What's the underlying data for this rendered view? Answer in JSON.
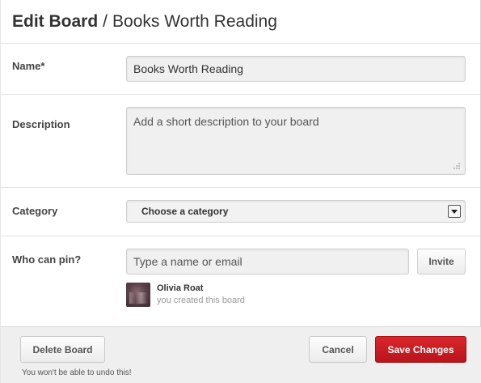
{
  "header": {
    "title_strong": "Edit Board",
    "separator": "/",
    "board_name": "Books Worth Reading"
  },
  "form": {
    "name": {
      "label": "Name*",
      "value": "Books Worth Reading"
    },
    "description": {
      "label": "Description",
      "placeholder": "Add a short description to your board"
    },
    "category": {
      "label": "Category",
      "selected": "Choose a category"
    },
    "collaborators": {
      "label": "Who can pin?",
      "placeholder": "Type a name or email",
      "invite_label": "Invite",
      "entries": [
        {
          "name": "Olivia Roat",
          "note": "you created this board"
        }
      ]
    }
  },
  "footer": {
    "delete_label": "Delete Board",
    "delete_note": "You won't be able to undo this!",
    "cancel_label": "Cancel",
    "save_label": "Save Changes"
  },
  "colors": {
    "save_button": "#c8181e",
    "footer_bg": "#efefef"
  },
  "icons": {
    "select_arrow": "triangle-down-icon",
    "resize_grip": "resize-grip-icon",
    "avatar": "user-avatar-photo"
  }
}
